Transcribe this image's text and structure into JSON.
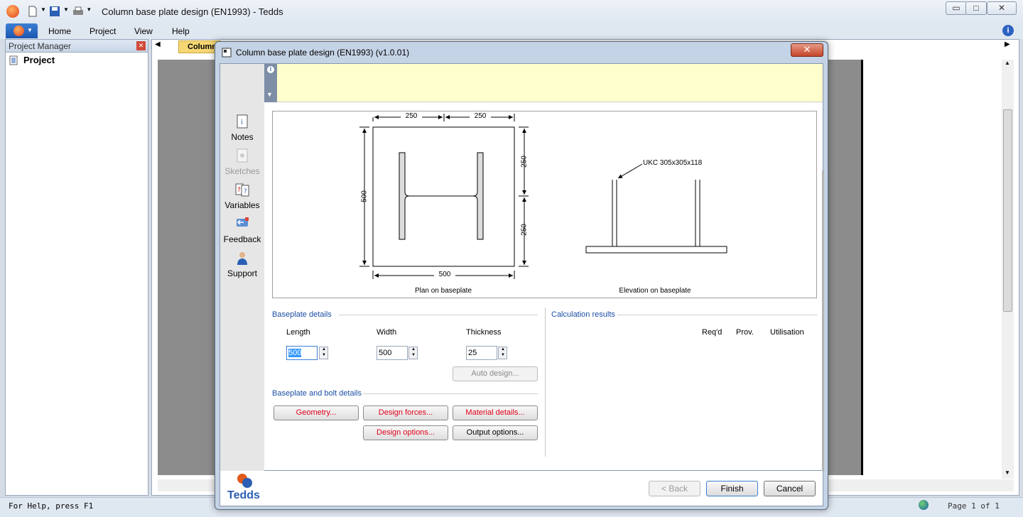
{
  "app": {
    "title": "Column base plate design (EN1993) - Tedds",
    "window_buttons": {
      "minimize": "▭",
      "maximize": "□",
      "close": "✕"
    }
  },
  "menu": {
    "items": [
      "Home",
      "Project",
      "View",
      "Help"
    ]
  },
  "project_manager": {
    "title": "Project Manager",
    "root": "Project"
  },
  "doc_tab": {
    "label": "Column"
  },
  "status": {
    "help": "For Help, press F1",
    "page": "Page 1 of 1"
  },
  "dialog": {
    "title": "Column base plate design (EN1993) (v1.0.01)",
    "close": "✕",
    "sidebar": [
      {
        "label": "Notes",
        "enabled": true
      },
      {
        "label": "Sketches",
        "enabled": false
      },
      {
        "label": "Variables",
        "enabled": true
      },
      {
        "label": "Feedback",
        "enabled": true
      },
      {
        "label": "Support",
        "enabled": true
      }
    ],
    "diagram": {
      "plan_caption": "Plan on baseplate",
      "elevation_caption": "Elevation on baseplate",
      "dim_top_left": "250",
      "dim_top_right": "250",
      "dim_bottom": "500",
      "dim_left": "500",
      "dim_right_top": "250",
      "dim_right_bottom": "250",
      "section_label": "UKC 305x305x118"
    },
    "baseplate_details": {
      "section_title": "Baseplate details",
      "length_label": "Length",
      "length_value": "500",
      "width_label": "Width",
      "width_value": "500",
      "thickness_label": "Thickness",
      "thickness_value": "25",
      "auto_design": "Auto design..."
    },
    "bolt_details": {
      "section_title": "Baseplate and bolt details",
      "geometry": "Geometry...",
      "design_forces": "Design forces...",
      "material_details": "Material details...",
      "design_options": "Design options...",
      "output_options": "Output options..."
    },
    "results": {
      "section_title": "Calculation results",
      "cols": [
        "Req'd",
        "Prov.",
        "Utilisation"
      ]
    },
    "footer": {
      "logo": "Tedds",
      "back": "< Back",
      "finish": "Finish",
      "cancel": "Cancel"
    }
  }
}
